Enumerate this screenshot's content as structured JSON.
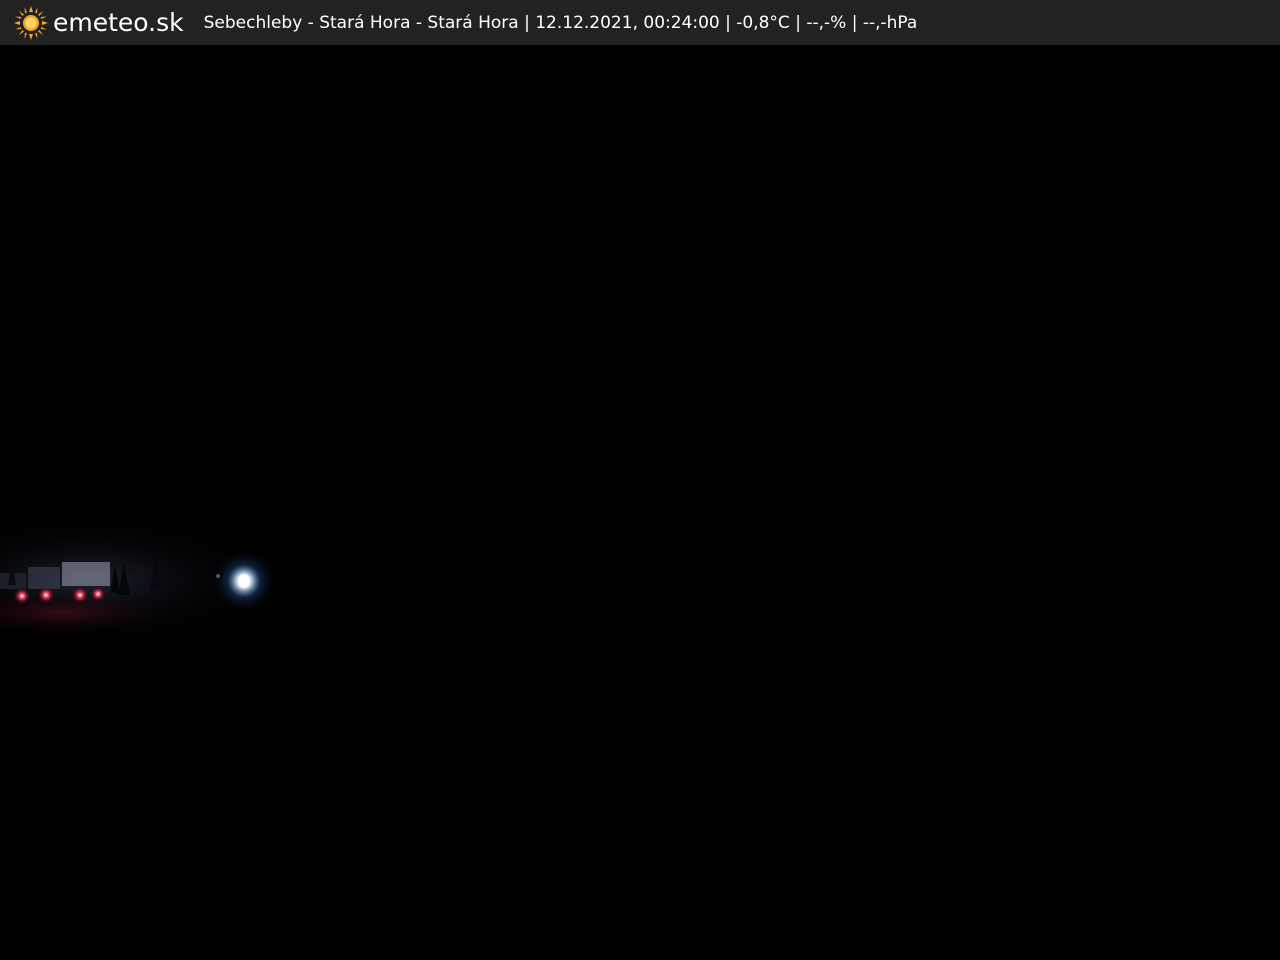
{
  "header": {
    "brand": "emeteo.sk",
    "logo_icon": "sun-icon",
    "caption": "Sebechleby - Stará Hora - Stará Hora | 12.12.2021, 00:24:00 | -0,8°C | --,-% | --,-hPa"
  },
  "colors": {
    "header_background": "#222222",
    "sun_color": "#f5a623",
    "header_text": "#ffffff"
  },
  "webcam": {
    "scene": "night-view"
  }
}
